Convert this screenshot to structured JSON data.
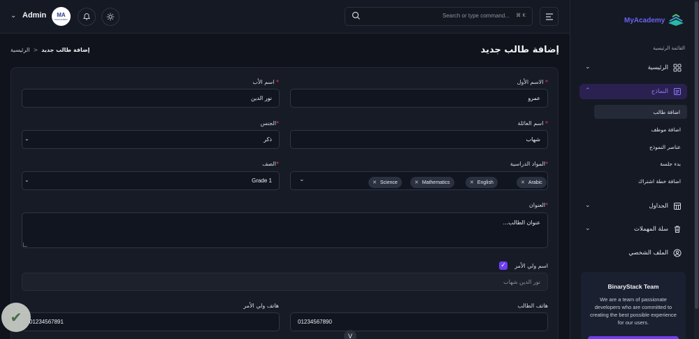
{
  "header": {
    "admin_label": "Admin",
    "avatar_text": "MA",
    "avatar_sub": "MYACADEMY",
    "search_placeholder": "Search or type command...",
    "search_shortcut": "⌘ K"
  },
  "breadcrumb": {
    "home": "الرئيسية",
    "separator": "<",
    "current": "إضافة طالب جديد"
  },
  "page_title": "إضافة طالب جديد",
  "form": {
    "first_name": {
      "label": "الاسم الأول",
      "value": "عمرو"
    },
    "father_name": {
      "label": "اسم الأب",
      "value": "نور الدين"
    },
    "family_name": {
      "label": "اسم العائلة",
      "value": "شهاب"
    },
    "gender": {
      "label": "الجنس",
      "value": "ذكر"
    },
    "subjects": {
      "label": "المواد الدراسية",
      "chips": [
        "Arabic",
        "English",
        "Mathematics",
        "Science"
      ]
    },
    "grade": {
      "label": "الصف",
      "value": "Grade 1"
    },
    "address": {
      "label": "العنوان",
      "value": "عنوان الطالب..."
    },
    "guardian_name": {
      "label": "اسم ولي الأمر",
      "checked": true,
      "value": "نور الدين شهاب"
    },
    "student_phone": {
      "label": "هاتف الطالب",
      "value": "01234567890"
    },
    "guardian_phone": {
      "label": "هاتف ولي الأمر",
      "value": "01234567891"
    },
    "required_mark": "*"
  },
  "collapse_label": "V",
  "sidebar": {
    "logo_text": "MyAcademy",
    "section_title": "القائمة الرئيسية",
    "items": [
      {
        "label": "الرئيسية",
        "icon": "grid-icon"
      },
      {
        "label": "النماذج",
        "icon": "form-icon"
      },
      {
        "label": "الجداول",
        "icon": "table-icon"
      },
      {
        "label": "سلة المهملات",
        "icon": "trash-icon"
      },
      {
        "label": "الملف الشخصي",
        "icon": "user-circle-icon"
      }
    ],
    "sub_items": [
      "اضافة طالب",
      "اضافة موظف",
      "عناصر النموذج",
      "بدء جلسة",
      "اضافة خطة اشتراك"
    ],
    "promo": {
      "title": "BinaryStack Team",
      "description": "We are a team of passionate developers who are committed to creating the best possible experience for our users."
    }
  },
  "colors": {
    "accent": "#6d3ff2",
    "required": "#e0435a",
    "background": "#10131c"
  }
}
